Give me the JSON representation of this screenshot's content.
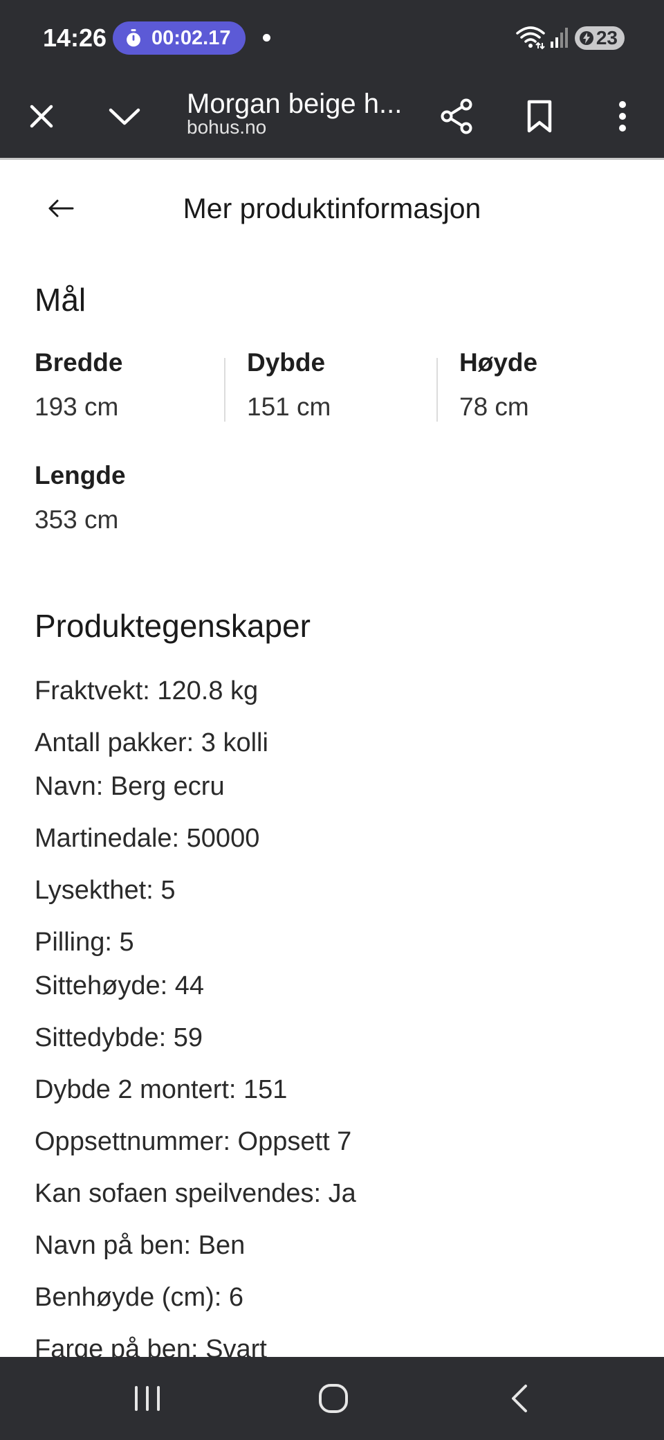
{
  "status_bar": {
    "time": "14:26",
    "timer": "00:02.17",
    "battery": "23",
    "accent_color": "#5c5ad6"
  },
  "toolbar": {
    "title": "Morgan beige h...",
    "url": "bohus.no",
    "icons": [
      "close-icon",
      "chevron-down-icon",
      "share-icon",
      "bookmark-icon",
      "more-vert-icon"
    ]
  },
  "page": {
    "title": "Mer produktinformasjon"
  },
  "dimensions": {
    "heading": "Mål",
    "bredde": {
      "label": "Bredde",
      "value": "193 cm"
    },
    "dybde": {
      "label": "Dybde",
      "value": "151 cm"
    },
    "hoyde": {
      "label": "Høyde",
      "value": "78 cm"
    },
    "lengde": {
      "label": "Lengde",
      "value": "353 cm"
    }
  },
  "properties": {
    "heading": "Produktegenskaper",
    "items": [
      "Fraktvekt: 120.8 kg",
      "Antall pakker: 3 kolli",
      "Navn: Berg ecru",
      "Martinedale: 50000",
      "Lysekthet: 5",
      "Pilling: 5",
      "Sittehøyde: 44",
      "Sittedybde: 59",
      "Dybde 2 montert: 151",
      "Oppsettnummer: Oppsett 7",
      "Kan sofaen speilvendes: Ja",
      "Navn på ben: Ben",
      "Benhøyde (cm): 6",
      "Farge på ben: Svart"
    ]
  },
  "nav_bar": {
    "icons": [
      "recent-apps-icon",
      "home-icon",
      "back-icon"
    ]
  }
}
